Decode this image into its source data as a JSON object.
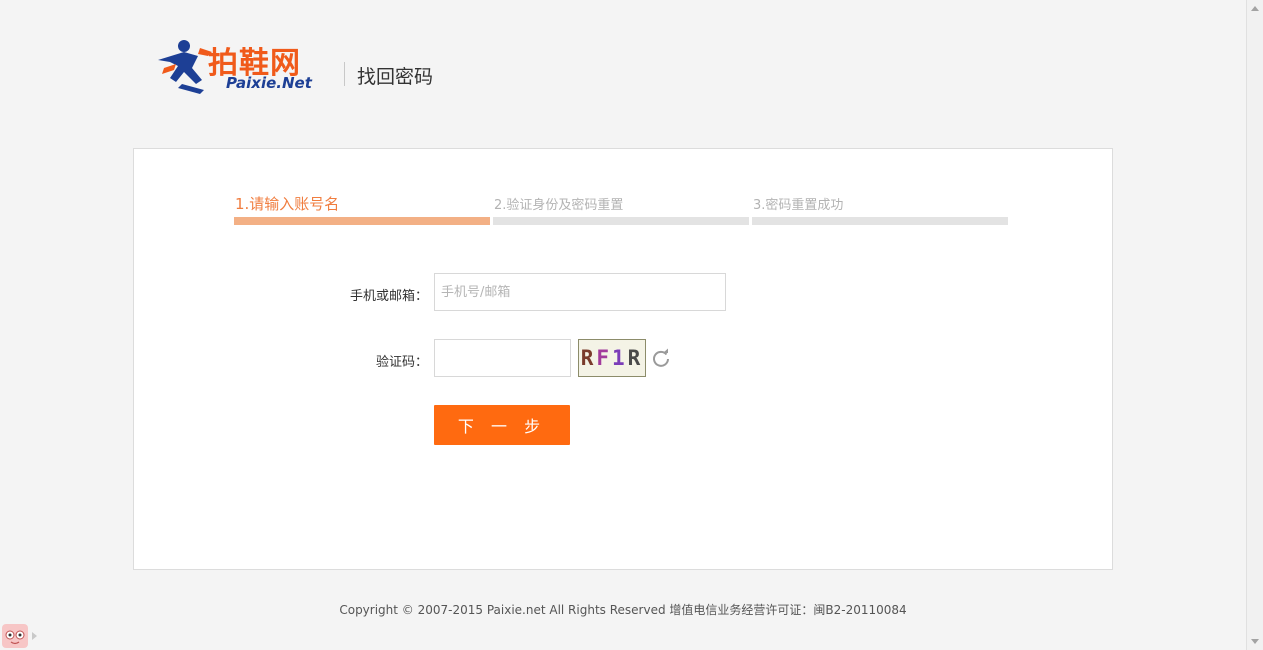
{
  "header": {
    "logo_cn": "拍鞋网",
    "logo_en": "Paixie",
    "logo_en_suffix": ".Net",
    "title": "找回密码"
  },
  "steps": [
    {
      "label": "1.请输入账号名",
      "active": true
    },
    {
      "label": "2.验证身份及密码重置",
      "active": false
    },
    {
      "label": "3.密码重置成功",
      "active": false
    }
  ],
  "form": {
    "account_label": "手机或邮箱：",
    "account_placeholder": "手机号/邮箱",
    "account_value": "",
    "captcha_label": "验证码：",
    "captcha_value": "",
    "captcha_chars": [
      "R",
      "F",
      "1",
      "R"
    ],
    "next_button": "下 一 步"
  },
  "footer": {
    "text": "Copyright © 2007-2015 Paixie.net All Rights Reserved 增值电信业务经营许可证：闽B2-20110084"
  },
  "colors": {
    "brand_orange": "#f05a1a",
    "brand_blue": "#1d3f95",
    "button": "#ff6a10",
    "active_step": "#f07d3f"
  }
}
